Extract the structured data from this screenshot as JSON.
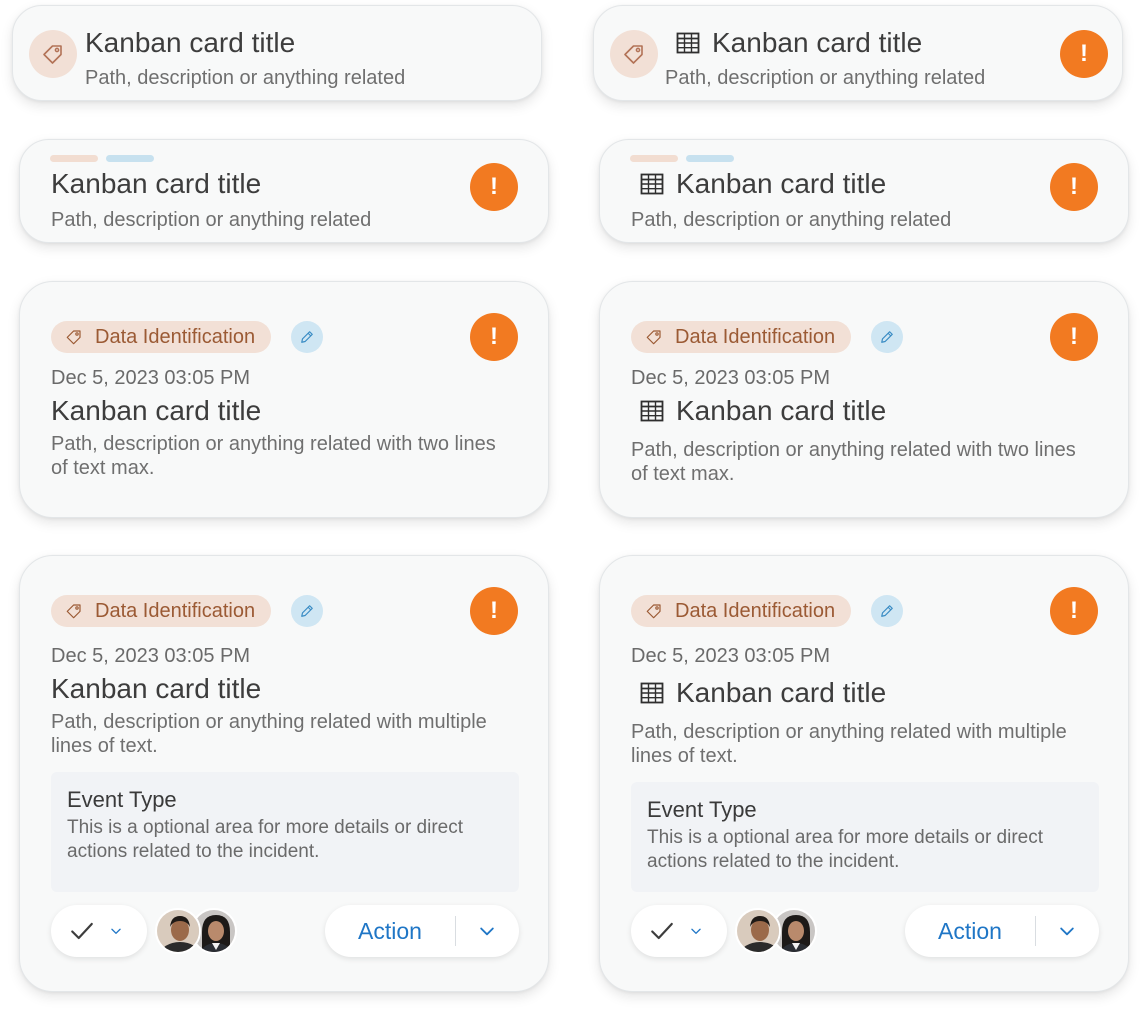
{
  "cards": [
    {
      "title": "Kanban card title",
      "description": "Path, description or anything related"
    },
    {
      "title": "Kanban card title",
      "description": "Path, description or anything related"
    },
    {
      "title": "Kanban card title",
      "description": "Path, description or anything related"
    },
    {
      "title": "Kanban card title",
      "description": "Path, description or anything related"
    },
    {
      "chip": "Data Identification",
      "date": "Dec 5, 2023 03:05 PM",
      "title": "Kanban card title",
      "description": "Path, description or anything related with two lines of text max."
    },
    {
      "chip": "Data Identification",
      "date": "Dec 5, 2023 03:05 PM",
      "title": "Kanban card title",
      "description": "Path, description or anything related with two lines of text max."
    },
    {
      "chip": "Data Identification",
      "date": "Dec 5, 2023 03:05 PM",
      "title": "Kanban card title",
      "description": "Path, description or anything related with multiple lines of text.",
      "event_title": "Event Type",
      "event_text": "This is a optional area for more details or direct actions related to the incident.",
      "action": "Action"
    },
    {
      "chip": "Data Identification",
      "date": "Dec 5, 2023 03:05 PM",
      "title": "Kanban card title",
      "description": "Path, description or anything related with multiple lines of text.",
      "event_title": "Event Type",
      "event_text": "This is a optional area for more details or direct actions related to the incident.",
      "action": "Action"
    }
  ],
  "alert_glyph": "!",
  "icons": [
    "tag-icon",
    "table-icon",
    "alert-icon",
    "pencil-icon",
    "check-icon",
    "chevron-down-icon"
  ],
  "colors": {
    "alert": "#f27a21",
    "tag_bg": "#f2e0d6",
    "tag_text": "#9b5a34",
    "edit_bg": "#cfe6f3",
    "action_text": "#1f76c6",
    "card_bg": "#f8f9f9"
  }
}
